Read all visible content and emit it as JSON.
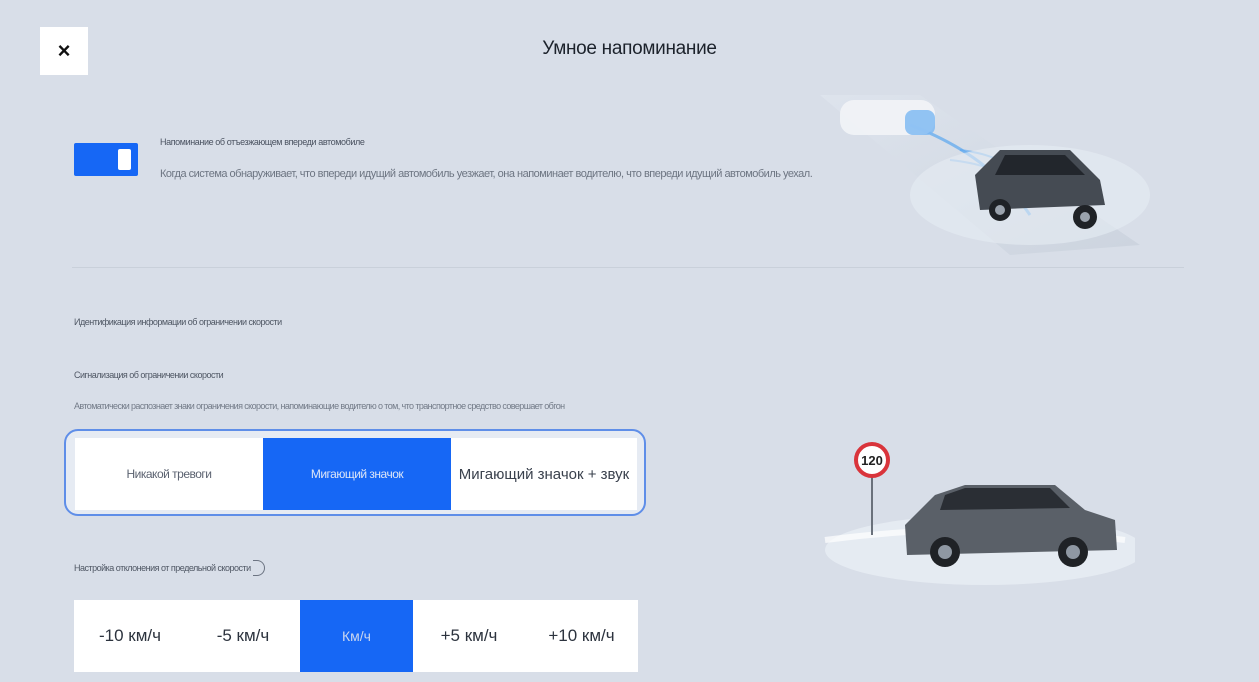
{
  "header": {
    "close_label": "×",
    "title": "Умное напоминание"
  },
  "departure_reminder": {
    "toggle_on": true,
    "title": "Напоминание об отъезжающем впереди автомобиле",
    "description": "Когда система обнаруживает, что впереди идущий автомобиль уезжает, она напоминает водителю, что впереди идущий автомобиль уехал."
  },
  "speed_limit": {
    "section_label": "Идентификация информации об ограничении скорости",
    "alert_title": "Сигнализация об ограничении скорости",
    "alert_desc": "Автоматически распознает знаки ограничения скорости, напоминающие водителю о том, что транспортное средство совершает обгон",
    "alert_options": [
      "Никакой тревоги",
      "Мигающий значок",
      "Мигающий значок + звук"
    ],
    "alert_selected": 1,
    "deviation_label": "Настройка отклонения от предельной скорости",
    "deviation_options": [
      "-10 км/ч",
      "-5 км/ч",
      "Км/ч",
      "+5 км/ч",
      "+10 км/ч"
    ],
    "deviation_selected": 2,
    "sign_value": "120"
  },
  "colors": {
    "accent": "#1667f5",
    "background": "#d8dee8"
  }
}
